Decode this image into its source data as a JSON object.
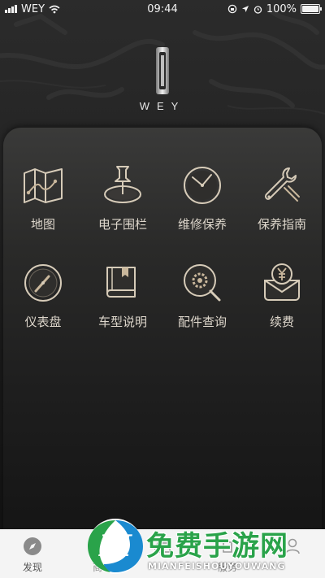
{
  "status_bar": {
    "carrier": "WEY",
    "time": "09:44",
    "battery": "100%"
  },
  "brand": {
    "name": "WEY"
  },
  "menu": [
    {
      "label": "地图",
      "icon": "map-icon"
    },
    {
      "label": "电子围栏",
      "icon": "geofence-pin-icon"
    },
    {
      "label": "维修保养",
      "icon": "clock-icon"
    },
    {
      "label": "保养指南",
      "icon": "wrench-icon"
    },
    {
      "label": "仪表盘",
      "icon": "gauge-icon"
    },
    {
      "label": "车型说明",
      "icon": "manual-book-icon"
    },
    {
      "label": "配件查询",
      "icon": "gear-search-icon"
    },
    {
      "label": "续费",
      "icon": "yen-wallet-icon"
    }
  ],
  "tabbar": {
    "tabs": [
      {
        "label": "发现",
        "icon": "compass-icon"
      },
      {
        "label": "商",
        "icon": "shop-icon"
      },
      {
        "label": "",
        "icon": "car-icon"
      },
      {
        "label": "服务",
        "icon": "service-icon"
      },
      {
        "label": "",
        "icon": "user-icon"
      }
    ]
  },
  "watermark": {
    "title": "免费手游网",
    "subtitle": "MIANFEISHOUYOUWANG"
  },
  "colors": {
    "accent_gold": "#c9b79c",
    "icon_stroke": "#d6cbb8",
    "watermark_green": "#2aa34a"
  }
}
